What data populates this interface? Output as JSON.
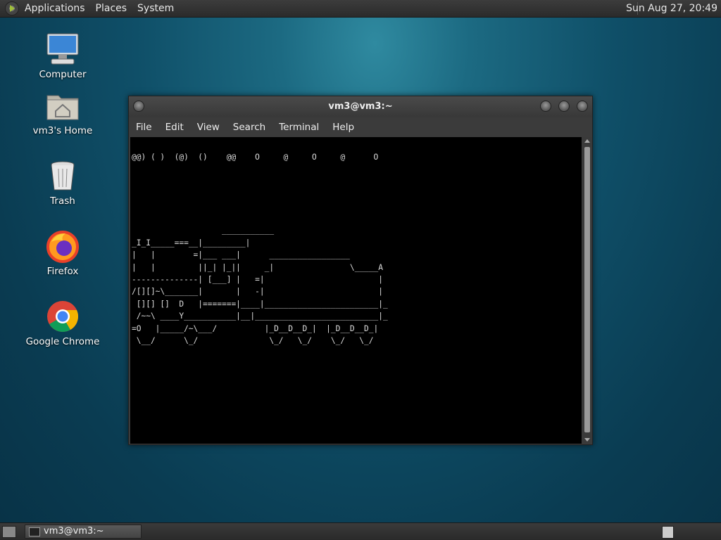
{
  "top_panel": {
    "menus": [
      "Applications",
      "Places",
      "System"
    ],
    "clock": "Sun Aug 27, 20:49"
  },
  "desktop_icons": [
    {
      "label": "Computer",
      "icon": "computer-icon"
    },
    {
      "label": "vm3's Home",
      "icon": "home-folder-icon"
    },
    {
      "label": "Trash",
      "icon": "trash-icon"
    },
    {
      "label": "Firefox",
      "icon": "firefox-icon"
    },
    {
      "label": "Google Chrome",
      "icon": "chrome-icon"
    }
  ],
  "terminal": {
    "title": "vm3@vm3:~",
    "menu": [
      "File",
      "Edit",
      "View",
      "Search",
      "Terminal",
      "Help"
    ],
    "lines": [
      "@@) ( )  (@)  ()    @@    O     @     O     @      O",
      "",
      "",
      "",
      "",
      "",
      "                   ___________",
      "_I_I_____===__|_________|",
      "|   |        =|___ ___|      _________________",
      "|   |         ||_| |_||     _|                \\_____A",
      "--------------| [___] |   =|                        |",
      "/[][]~\\_______|       |   -|                        |",
      " [][] []  D   |=======|____|________________________|_",
      " /~~\\ ____Y___________|__|__________________________|_",
      "=O   |_____/~\\___/          |_D__D__D_|  |_D__D__D_|",
      " \\__/      \\_/               \\_/   \\_/    \\_/   \\_/"
    ]
  },
  "taskbar": {
    "tasks": [
      {
        "label": "vm3@vm3:~"
      }
    ]
  }
}
